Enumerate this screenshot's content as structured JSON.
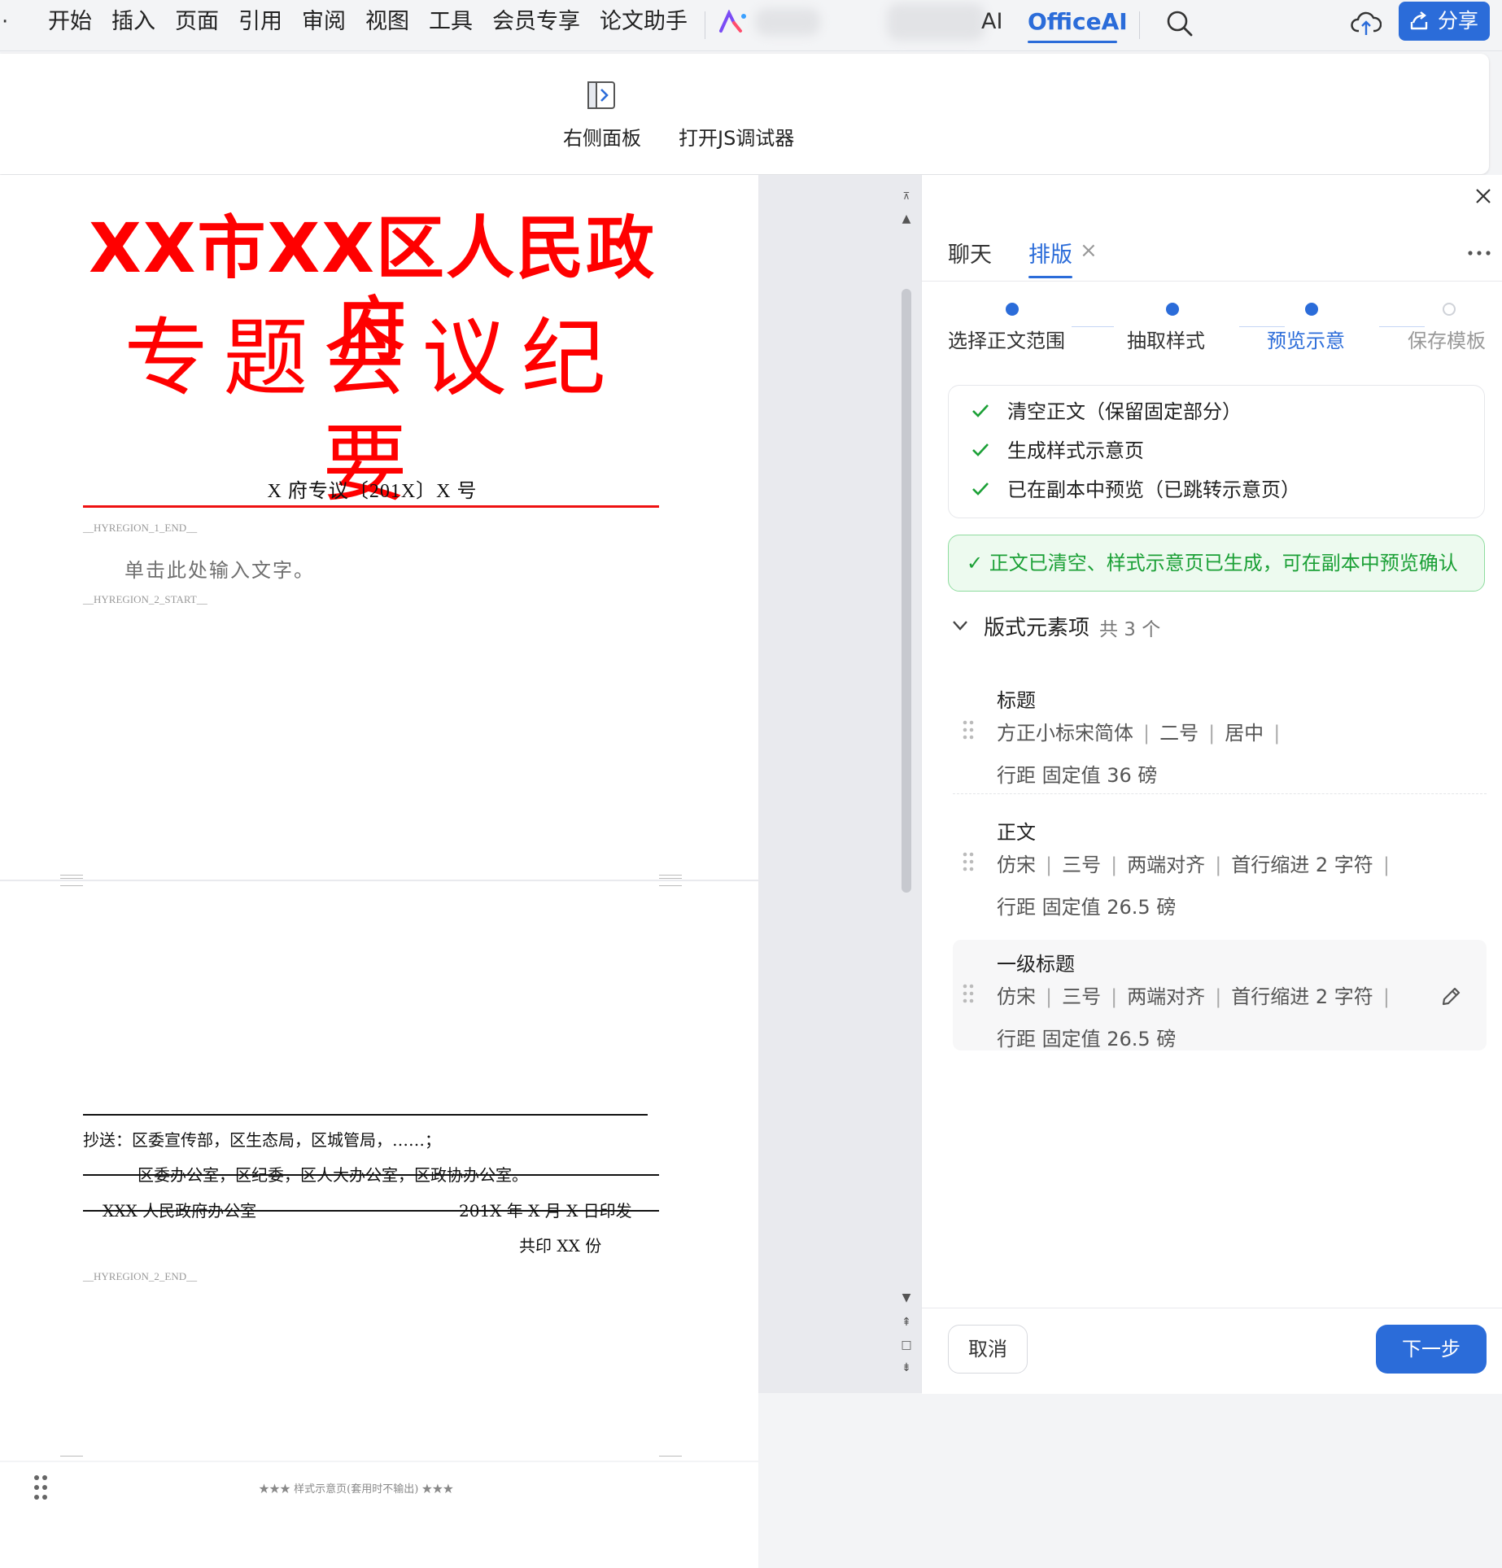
{
  "menubar": {
    "items": [
      "开始",
      "插入",
      "页面",
      "引用",
      "审阅",
      "视图",
      "工具",
      "会员专享",
      "论文助手"
    ],
    "ai_fragment": "AI",
    "officeai_tab": "OfficeAI",
    "share_label": "分享"
  },
  "ribbon": {
    "right_panel_label": "右侧面板",
    "js_debugger_label": "打开JS调试器"
  },
  "document": {
    "title_line1": "XX市XX区人民政府",
    "title_line2": "专题会议纪要",
    "doc_number": "X 府专议〔201X〕X 号",
    "region1_end": "__HYREGION_1_END__",
    "placeholder": "单击此处输入文字。",
    "region2_start": "__HYREGION_2_START__",
    "cc_line1": "抄送：区委宣传部，区生态局，区城管局，……；",
    "cc_line2": "区委办公室，区纪委，区人大办公室，区政协办公室。",
    "issuer": "XXX 人民政府办公室",
    "issue_date": "201X 年 X 月 X 日印发",
    "copies": "共印 XX 份",
    "region2_end": "__HYREGION_2_END__",
    "preview_caption": "★★★   样式示意页(套用时不输出)   ★★★"
  },
  "panel": {
    "tabs": {
      "chat": "聊天",
      "layout": "排版",
      "layout_close": "×"
    },
    "steps": [
      {
        "label": "选择正文范围",
        "state": "done"
      },
      {
        "label": "抽取样式",
        "state": "done"
      },
      {
        "label": "预览示意",
        "state": "active"
      },
      {
        "label": "保存模板",
        "state": "pending"
      }
    ],
    "checklist": [
      "清空正文（保留固定部分）",
      "生成样式示意页",
      "已在副本中预览（已跳转示意页）"
    ],
    "success_message": "✓ 正文已清空、样式示意页已生成，可在副本中预览确认",
    "section": {
      "title": "版式元素项",
      "count": "共 3 个"
    },
    "elements": [
      {
        "title": "标题",
        "props": [
          "方正小标宋简体",
          "二号",
          "居中"
        ],
        "spacing": "行距 固定值 36 磅"
      },
      {
        "title": "正文",
        "props": [
          "仿宋",
          "三号",
          "两端对齐",
          "首行缩进 2 字符"
        ],
        "spacing": "行距 固定值 26.5 磅"
      },
      {
        "title": "一级标题",
        "props": [
          "仿宋",
          "三号",
          "两端对齐",
          "首行缩进 2 字符"
        ],
        "spacing": "行距 固定值 26.5 磅"
      }
    ],
    "footer": {
      "cancel": "取消",
      "next": "下一步"
    }
  },
  "colors": {
    "accent": "#2b6cd9",
    "doc_red": "#ff0000",
    "success_green": "#1ba036"
  }
}
